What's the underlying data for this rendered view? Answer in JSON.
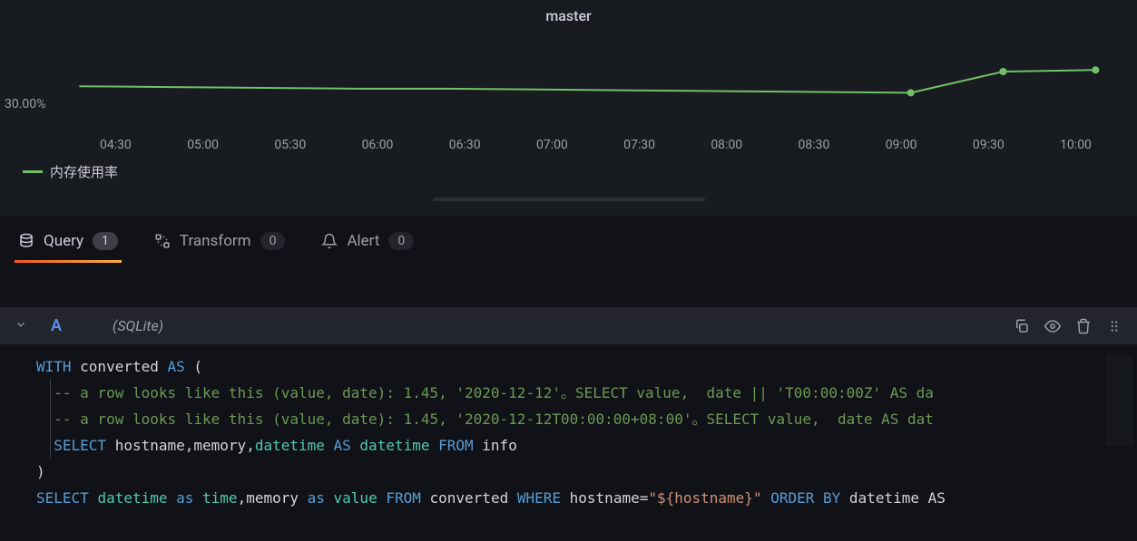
{
  "panel": {
    "title": "master",
    "legend_label": "内存使用率",
    "y_label": "30.00%",
    "x_ticks": [
      "04:30",
      "05:00",
      "05:30",
      "06:00",
      "06:30",
      "07:00",
      "07:30",
      "08:00",
      "08:30",
      "09:00",
      "09:30",
      "10:00"
    ]
  },
  "chart_data": {
    "type": "line",
    "title": "master",
    "xlabel": "",
    "ylabel": "",
    "ylim": [
      25,
      35
    ],
    "series": [
      {
        "name": "内存使用率",
        "color": "#73bf69",
        "x": [
          "04:30",
          "05:00",
          "05:30",
          "06:00",
          "06:30",
          "07:00",
          "07:30",
          "08:00",
          "08:30",
          "09:00",
          "09:30",
          "10:00"
        ],
        "y": [
          30.2,
          30.1,
          30.0,
          29.9,
          29.9,
          29.8,
          29.7,
          29.6,
          29.5,
          29.4,
          32.0,
          32.2
        ]
      }
    ]
  },
  "tabs": {
    "query": {
      "label": "Query",
      "count": "1"
    },
    "transform": {
      "label": "Transform",
      "count": "0"
    },
    "alert": {
      "label": "Alert",
      "count": "0"
    }
  },
  "query": {
    "letter": "A",
    "datasource": "(SQLite)"
  },
  "code": {
    "l1_with": "WITH",
    "l1_conv": " converted ",
    "l1_as": "AS",
    "l1_paren": " (",
    "l2": "  -- a row looks like this (value, date): 1.45, '2020-12-12'。SELECT value,  date || 'T00:00:00Z' AS da",
    "l3": "  -- a row looks like this (value, date): 1.45, '2020-12-12T00:00:00+08:00'。SELECT value,  date AS dat",
    "l4_select": "  SELECT",
    "l4_mid": " hostname,memory,",
    "l4_dt": "datetime",
    "l4_as": " AS ",
    "l4_dt2": "datetime",
    "l4_from": " FROM",
    "l4_info": " info",
    "l5": ")",
    "l6_select": "SELECT ",
    "l6_dt": "datetime",
    "l6_as": " as ",
    "l6_time": "time",
    "l6_mem": ",memory ",
    "l6_as2": "as ",
    "l6_val": "value",
    "l6_from": " FROM",
    "l6_conv": " converted ",
    "l6_where": "WHERE",
    "l6_host": " hostname=",
    "l6_str": "\"${hostname}\"",
    "l6_order": " ORDER BY",
    "l6_end": " datetime AS"
  }
}
